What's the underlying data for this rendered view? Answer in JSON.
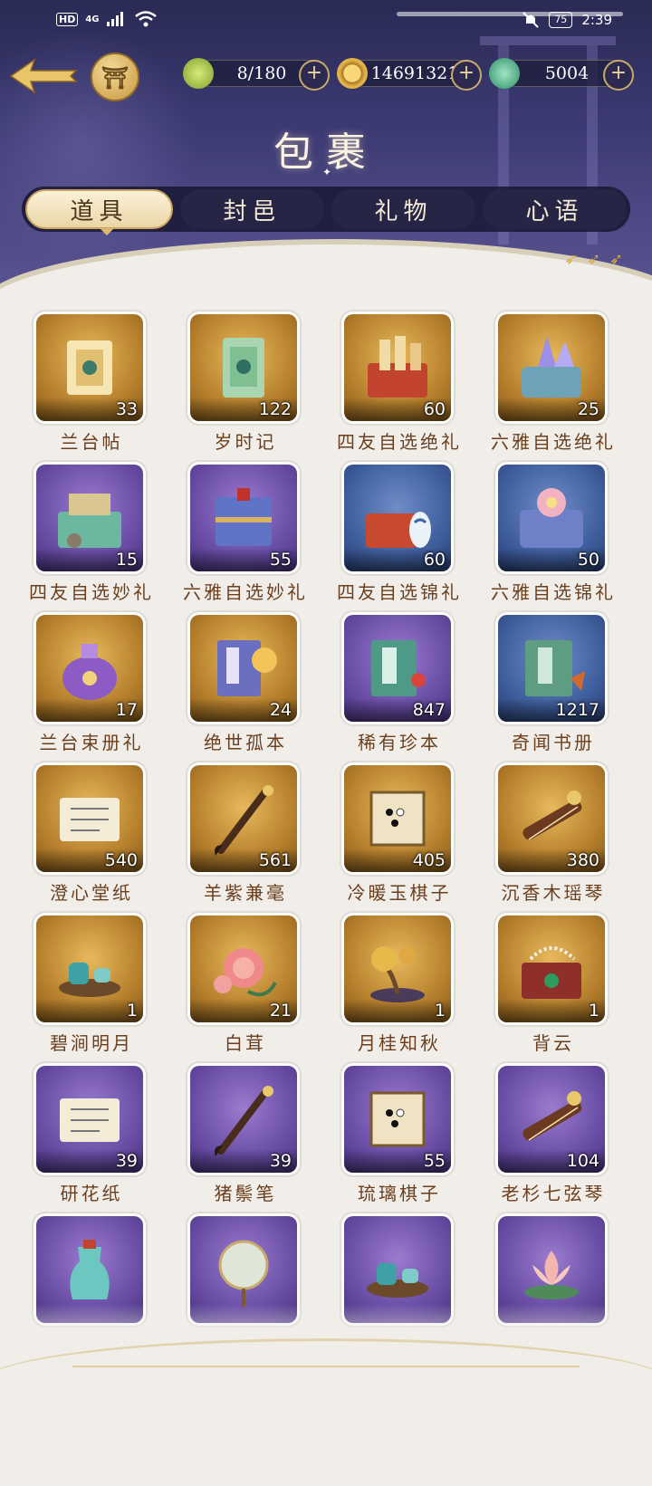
{
  "status_bar": {
    "hd": "HD",
    "signal": "4G",
    "battery": "75",
    "time": "2:39"
  },
  "resources": [
    {
      "icon": "leaf-stamina-icon",
      "value": "8/180"
    },
    {
      "icon": "coin-icon",
      "value": "14691321"
    },
    {
      "icon": "jade-bell-icon",
      "value": "5004"
    }
  ],
  "title": "包裹",
  "tabs": [
    {
      "label": "道具",
      "active": true
    },
    {
      "label": "封邑",
      "active": false
    },
    {
      "label": "礼物",
      "active": false
    },
    {
      "label": "心语",
      "active": false
    }
  ],
  "items": [
    {
      "name": "兰台帖",
      "count": "33",
      "frame": "gold",
      "icon": "scroll-letter-icon"
    },
    {
      "name": "岁时记",
      "count": "122",
      "frame": "gold",
      "icon": "green-book-icon"
    },
    {
      "name": "四友自选绝礼",
      "count": "60",
      "frame": "gold",
      "icon": "red-giftbox-scrolls-icon"
    },
    {
      "name": "六雅自选绝礼",
      "count": "25",
      "frame": "gold",
      "icon": "crystal-giftbox-icon"
    },
    {
      "name": "四友自选妙礼",
      "count": "15",
      "frame": "purple",
      "icon": "green-giftbox-icon"
    },
    {
      "name": "六雅自选妙礼",
      "count": "55",
      "frame": "purple",
      "icon": "blue-chest-icon"
    },
    {
      "name": "四友自选锦礼",
      "count": "60",
      "frame": "blue",
      "icon": "red-giftbox-vase-icon"
    },
    {
      "name": "六雅自选锦礼",
      "count": "50",
      "frame": "blue",
      "icon": "blossom-giftbox-icon"
    },
    {
      "name": "兰台束册礼",
      "count": "17",
      "frame": "gold",
      "icon": "purple-pouch-icon"
    },
    {
      "name": "绝世孤本",
      "count": "24",
      "frame": "gold",
      "icon": "rare-book-icon"
    },
    {
      "name": "稀有珍本",
      "count": "847",
      "frame": "purple",
      "icon": "jade-book-icon"
    },
    {
      "name": "奇闻书册",
      "count": "1217",
      "frame": "blue",
      "icon": "story-book-icon"
    },
    {
      "name": "澄心堂纸",
      "count": "540",
      "frame": "gold",
      "icon": "paper-scroll-icon"
    },
    {
      "name": "羊紫兼毫",
      "count": "561",
      "frame": "gold",
      "icon": "brush-icon"
    },
    {
      "name": "冷暖玉棋子",
      "count": "405",
      "frame": "gold",
      "icon": "go-board-icon"
    },
    {
      "name": "沉香木瑶琴",
      "count": "380",
      "frame": "gold",
      "icon": "guqin-icon"
    },
    {
      "name": "碧涧明月",
      "count": "1",
      "frame": "gold",
      "icon": "tea-set-icon"
    },
    {
      "name": "白茸",
      "count": "21",
      "frame": "gold",
      "icon": "peony-icon"
    },
    {
      "name": "月桂知秋",
      "count": "1",
      "frame": "gold",
      "icon": "bonsai-icon"
    },
    {
      "name": "背云",
      "count": "1",
      "frame": "gold",
      "icon": "jewelry-box-icon"
    },
    {
      "name": "研花纸",
      "count": "39",
      "frame": "purple",
      "icon": "paper-scroll-icon"
    },
    {
      "name": "猪鬃笔",
      "count": "39",
      "frame": "purple",
      "icon": "brush-icon"
    },
    {
      "name": "琉璃棋子",
      "count": "55",
      "frame": "purple",
      "icon": "go-board-icon"
    },
    {
      "name": "老杉七弦琴",
      "count": "104",
      "frame": "purple",
      "icon": "guqin-icon"
    },
    {
      "name": "",
      "count": "",
      "frame": "purple",
      "icon": "wine-flask-icon"
    },
    {
      "name": "",
      "count": "",
      "frame": "purple",
      "icon": "round-fan-icon"
    },
    {
      "name": "",
      "count": "",
      "frame": "purple",
      "icon": "tea-set-icon"
    },
    {
      "name": "",
      "count": "",
      "frame": "purple",
      "icon": "lotus-icon"
    }
  ],
  "colors": {
    "header_dark": "#2a2a55",
    "header_light": "#5a5592",
    "name_text": "#6b3f1e",
    "tab_active_bg": "#fbf1d8",
    "frame_gold": "#b7812d",
    "frame_purple": "#6a4ea6",
    "frame_blue": "#3f5f9e"
  }
}
